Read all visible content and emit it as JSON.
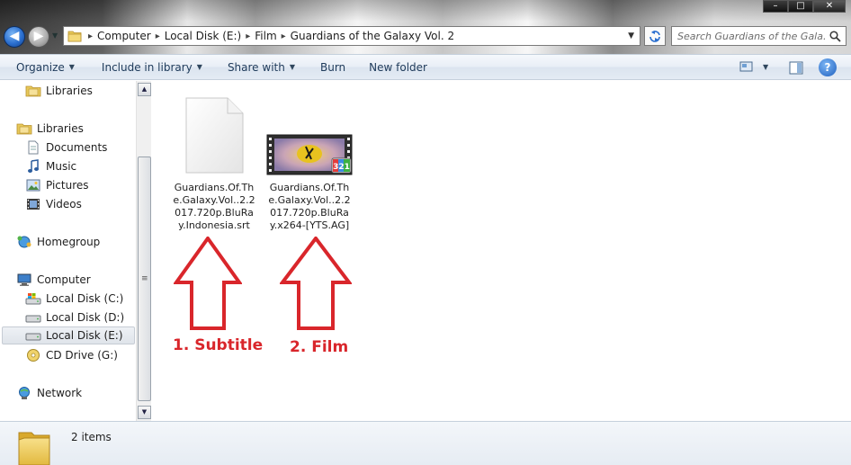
{
  "window": {
    "caption_minimize": "–",
    "caption_maximize": "□",
    "caption_close": "✕"
  },
  "address": {
    "breadcrumbs": [
      "Computer",
      "Local Disk (E:)",
      "Film",
      "Guardians of the Galaxy Vol. 2"
    ],
    "separator": "▸"
  },
  "search": {
    "placeholder": "Search Guardians of the Gala..."
  },
  "command_bar": {
    "organize": "Organize",
    "include_in_library": "Include in library",
    "share_with": "Share with",
    "burn": "Burn",
    "new_folder": "New folder",
    "help": "?"
  },
  "nav_pane": {
    "items": [
      {
        "label": "Libraries",
        "icon": "libraries-icon"
      },
      {
        "label": "Libraries",
        "icon": "libraries-icon"
      },
      {
        "label": "Documents",
        "icon": "documents-icon"
      },
      {
        "label": "Music",
        "icon": "music-icon"
      },
      {
        "label": "Pictures",
        "icon": "pictures-icon"
      },
      {
        "label": "Videos",
        "icon": "videos-icon"
      },
      {
        "label": "Homegroup",
        "icon": "homegroup-icon"
      },
      {
        "label": "Computer",
        "icon": "computer-icon"
      },
      {
        "label": "Local Disk (C:)",
        "icon": "system-drive-icon"
      },
      {
        "label": "Local Disk (D:)",
        "icon": "drive-icon"
      },
      {
        "label": "Local Disk (E:)",
        "icon": "drive-icon",
        "selected": true
      },
      {
        "label": "CD Drive (G:)",
        "icon": "cd-drive-icon"
      },
      {
        "label": "Network",
        "icon": "network-icon"
      }
    ]
  },
  "files": [
    {
      "name": "Guardians.Of.The.Galaxy.Vol..2.2017.720p.BluRay.Indonesia.srt",
      "icon": "blank-document-icon"
    },
    {
      "name": "Guardians.Of.The.Galaxy.Vol..2.2017.720p.BluRay.x264-[YTS.AG]",
      "icon": "video-file-icon"
    }
  ],
  "annotations": {
    "subtitle_label": "1. Subtitle",
    "film_label": "2. Film",
    "color": "#d9262b"
  },
  "status": {
    "item_count": "2 items"
  },
  "colors": {
    "accent": "#2b6fcf",
    "command_text": "#1e3a5a",
    "annotation": "#d9262b"
  }
}
